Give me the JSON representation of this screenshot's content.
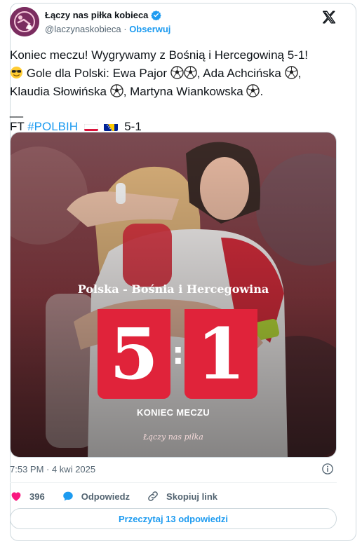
{
  "account": {
    "name": "Łączy nas piłka kobieca",
    "handle": "@laczynaskobieca",
    "separator": "·",
    "follow_label": "Obserwuj"
  },
  "tweet": {
    "line1": "Koniec meczu! Wygrywamy z Bośnią i Hercegowiną 5-1!",
    "line2_text": "Gole dla Polski: Ewa Pajor",
    "line2_sep": ", Ada Achcińska",
    "line3_text": "Klaudia Słowińska",
    "line3_sep": ", Martyna Wiankowska",
    "line3_end": ".",
    "rule": "__",
    "ft": "FT",
    "hashtag": "#POLBIH",
    "score": "5-1"
  },
  "graphic": {
    "teams": "Polska  -  Bośnia i Hercegowina",
    "home_score": "5",
    "colon": ":",
    "away_score": "1",
    "status": "KONIEC MECZU",
    "brand": "Łączy nas piłka"
  },
  "meta": {
    "timestamp": "7:53 PM · 4 kwi 2025"
  },
  "actions": {
    "likes": "396",
    "reply_label": "Odpowiedz",
    "copy_label": "Skopiuj link"
  },
  "read_replies_label": "Przeczytaj 13 odpowiedzi",
  "colors": {
    "accent": "#1d9bf0",
    "score_red": "#e0233a",
    "like_pink": "#f91880"
  },
  "icons": [
    "verified-icon",
    "x-logo-icon",
    "soccer-ball-icon",
    "poland-flag-icon",
    "bosnia-flag-icon",
    "info-icon",
    "heart-icon",
    "reply-bubble-icon",
    "link-icon"
  ]
}
